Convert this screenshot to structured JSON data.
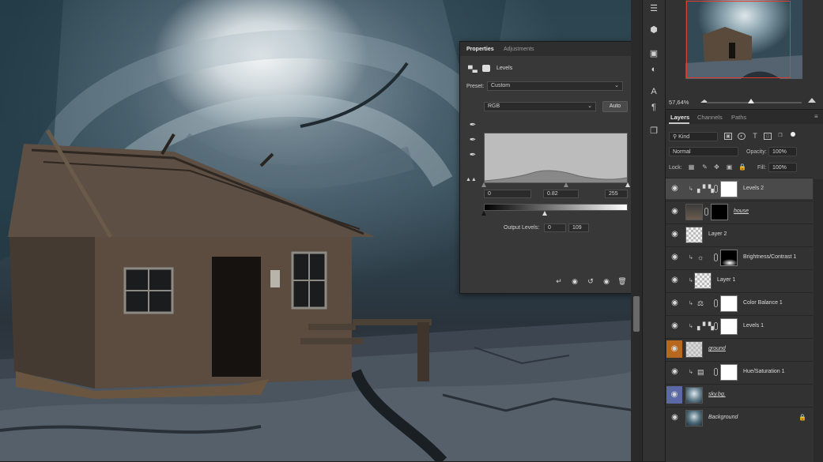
{
  "properties": {
    "tabs": [
      "Properties",
      "Adjustments"
    ],
    "adjustment_name": "Levels",
    "preset_label": "Preset:",
    "preset_value": "Custom",
    "channel": "RGB",
    "auto_label": "Auto",
    "input_levels": {
      "black": "0",
      "gamma": "0.82",
      "white": "255"
    },
    "output_label": "Output Levels:",
    "output_levels": {
      "black": "0",
      "white": "109"
    }
  },
  "navigator": {
    "zoom": "57,64%"
  },
  "layers_panel": {
    "tabs": [
      "Layers",
      "Channels",
      "Paths"
    ],
    "filter_kind": "Kind",
    "blend_mode": "Normal",
    "opacity_label": "Opacity:",
    "opacity_value": "100%",
    "lock_label": "Lock:",
    "fill_label": "Fill:",
    "fill_value": "100%",
    "layers": [
      {
        "name": "Levels 2"
      },
      {
        "name": "house"
      },
      {
        "name": "Layer 2"
      },
      {
        "name": "Brightness/Contrast 1"
      },
      {
        "name": "Layer 1"
      },
      {
        "name": "Color Balance 1"
      },
      {
        "name": "Levels 1"
      },
      {
        "name": "ground"
      },
      {
        "name": "Hue/Saturation 1"
      },
      {
        "name": "sky.bg."
      },
      {
        "name": "Background"
      }
    ]
  },
  "icons": {
    "visibility": "eye-icon",
    "lock": "lock-icon",
    "eyedropper": "eyedropper-icon"
  },
  "colors": {
    "selection_red": "#e23b2e",
    "ground_highlight": "#b8681c",
    "sky_highlight": "#5b6aa6",
    "cursor_highlight": "#f2d60c"
  }
}
